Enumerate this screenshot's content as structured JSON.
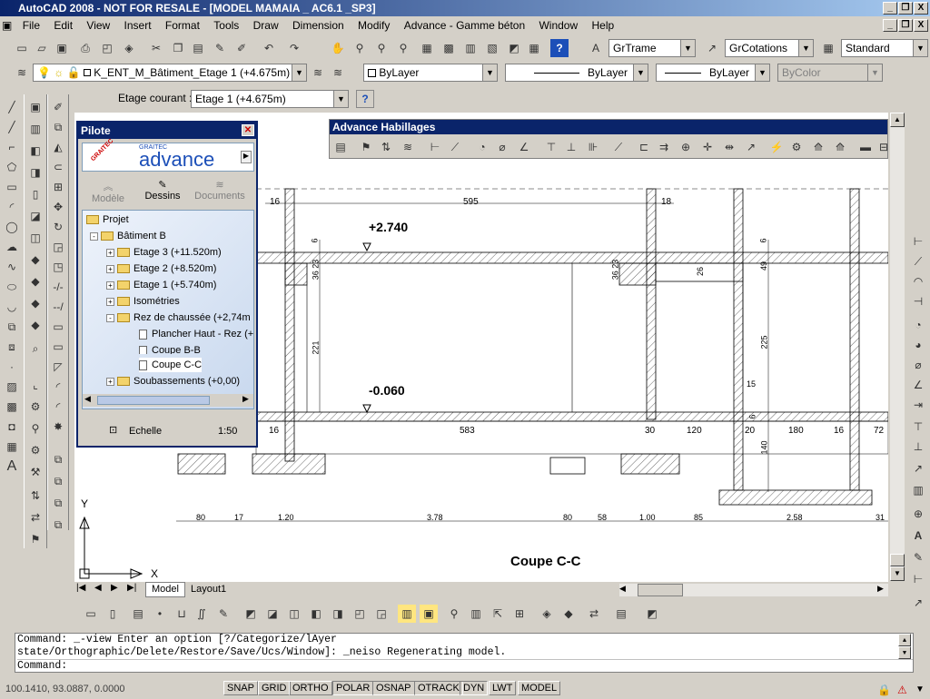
{
  "window": {
    "title": "AutoCAD 2008 - NOT FOR RESALE - [MODEL MAMAIA _ AC6.1 _SP3]",
    "controls": [
      "_",
      "❐",
      "X"
    ]
  },
  "menu": [
    "File",
    "Edit",
    "View",
    "Insert",
    "Format",
    "Tools",
    "Draw",
    "Dimension",
    "Modify",
    "Advance - Gamme béton",
    "Window",
    "Help"
  ],
  "toolbar1": {
    "text_style": "GrTrame",
    "dim_style": "GrCotations",
    "table_style": "Standard"
  },
  "toolbar2": {
    "layer": "K_ENT_M_Bâtiment_Etage 1 (+4.675m)",
    "color": "ByLayer",
    "linetype": "ByLayer",
    "lineweight": "ByLayer",
    "plotstyle": "ByColor"
  },
  "etage": {
    "label": "Etage courant :",
    "value": "Etage 1 (+4.675m)"
  },
  "pilote": {
    "title": "Pilote",
    "logo": "advance",
    "brand": "GRAITEC",
    "tabs": [
      "Modèle",
      "Dessins",
      "Documents"
    ],
    "tree": [
      {
        "label": "Projet",
        "level": 0,
        "toggle": ""
      },
      {
        "label": "Bâtiment B",
        "level": 1,
        "toggle": "-"
      },
      {
        "label": "Etage 3 (+11.520m)",
        "level": 2,
        "toggle": "+"
      },
      {
        "label": "Etage 2 (+8.520m)",
        "level": 2,
        "toggle": "+"
      },
      {
        "label": "Etage 1 (+5.740m)",
        "level": 2,
        "toggle": "+"
      },
      {
        "label": "Isométries",
        "level": 2,
        "toggle": "+"
      },
      {
        "label": "Rez de chaussée (+2,74m",
        "level": 2,
        "toggle": "-"
      },
      {
        "label": "Plancher Haut - Rez (+",
        "level": 3,
        "toggle": ""
      },
      {
        "label": "Coupe B-B",
        "level": 3,
        "toggle": ""
      },
      {
        "label": "Coupe C-C",
        "level": 3,
        "toggle": ""
      },
      {
        "label": "Soubassements (+0,00)",
        "level": 2,
        "toggle": "+"
      }
    ],
    "scale_label": "Echelle",
    "scale_value": "1:50"
  },
  "habillages": {
    "title": "Advance Habillages"
  },
  "drawing": {
    "section_title": "Coupe C-C",
    "level_top": "+2.740",
    "level_bottom": "-0.060",
    "dims_top": [
      "16",
      "595",
      "18"
    ],
    "dims_bottom": [
      "16",
      "583",
      "30",
      "120",
      "20",
      "180",
      "16",
      "72"
    ],
    "dims_vertical": [
      "6",
      "36 23",
      "221",
      "36 23",
      "26",
      "6",
      "49",
      "225",
      "15",
      "6",
      "140"
    ],
    "dims_axis": [
      "80",
      "17",
      "1.20",
      "3.78",
      "80",
      "58",
      "1.00",
      "85",
      "2.58",
      "31"
    ],
    "ucs_x": "X",
    "ucs_y": "Y"
  },
  "tabs": [
    "Model",
    "Layout1"
  ],
  "command": {
    "line1": "Command: _-view Enter an option [?/Categorize/lAyer",
    "line2": "state/Orthographic/Delete/Restore/Save/Ucs/Window]: _neiso Regenerating model.",
    "line3": "Command:"
  },
  "status": {
    "coords": "100.1410, 93.0887, 0.0000",
    "toggles": [
      "SNAP",
      "GRID",
      "ORTHO",
      "POLAR",
      "OSNAP",
      "OTRACK",
      "DYN",
      "LWT",
      "MODEL"
    ]
  }
}
